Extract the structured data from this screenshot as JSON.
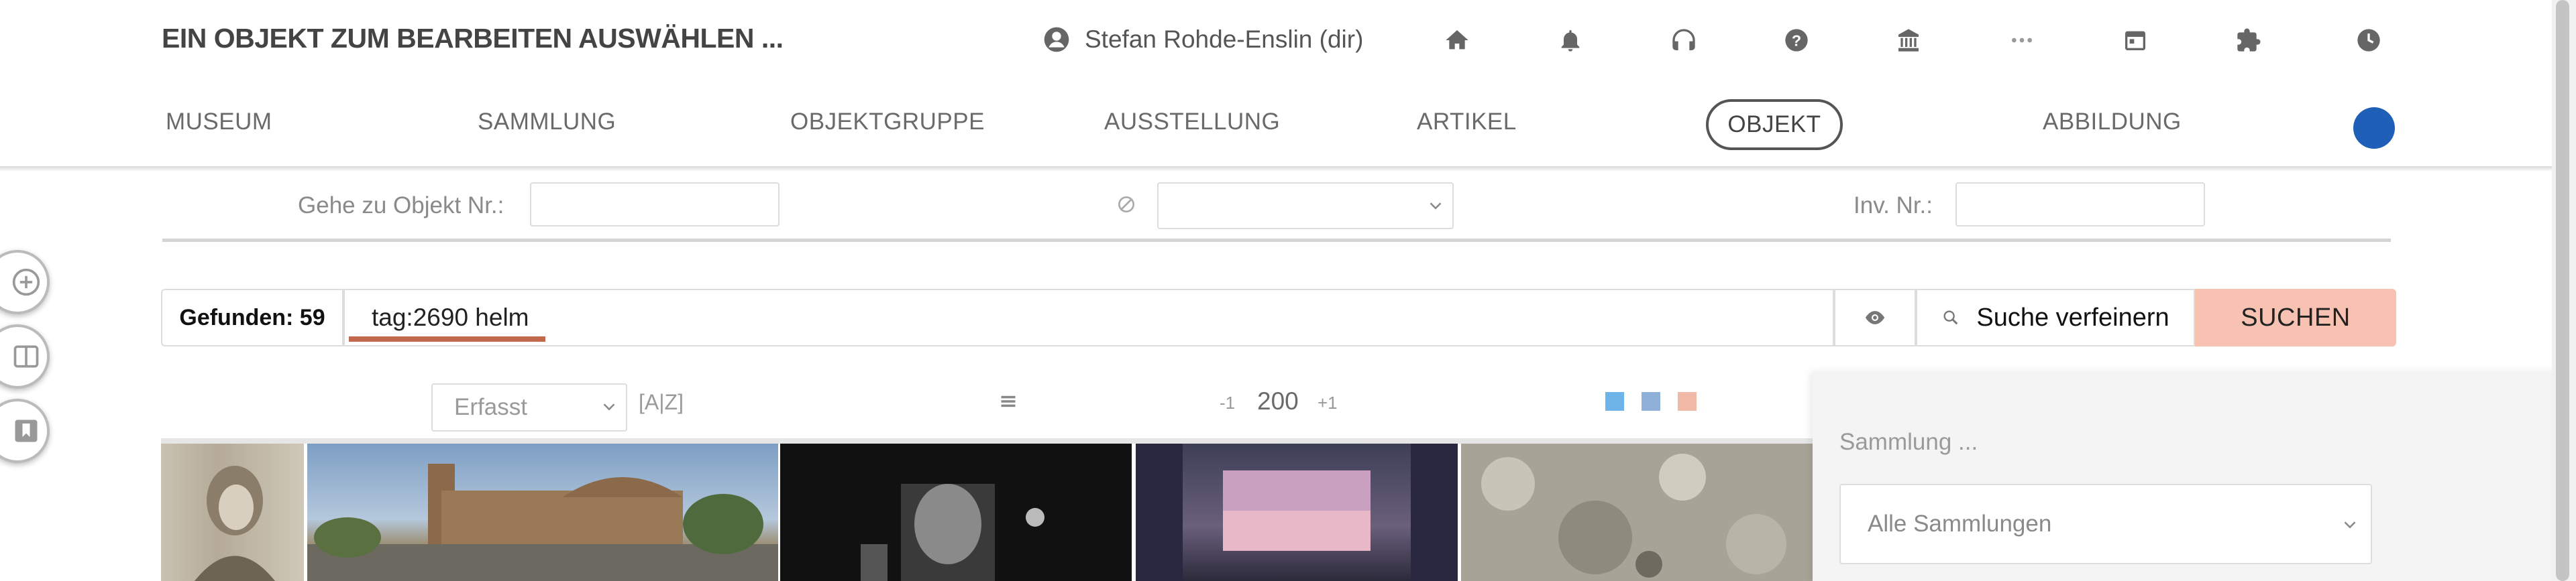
{
  "header": {
    "title": "EIN OBJEKT ZUM BEARBEITEN AUSWÄHLEN ...",
    "user_name": "Stefan Rohde-Enslin (dir)",
    "icons": [
      "home-icon",
      "bell-icon",
      "help-icon",
      "question-icon",
      "museum-icon",
      "more-icon",
      "calendar-icon",
      "puzzle-icon",
      "clock-icon"
    ]
  },
  "nav": {
    "tabs": [
      "MUSEUM",
      "SAMMLUNG",
      "OBJEKTGRUPPE",
      "AUSSTELLUNG",
      "ARTIKEL",
      "OBJEKT",
      "ABBILDUNG"
    ],
    "active": "OBJEKT",
    "avatar_color": "#1f5fb8"
  },
  "side_buttons": [
    "add-icon",
    "book-icon",
    "bookmark-icon"
  ],
  "filter": {
    "goto_label": "Gehe zu Objekt Nr.:",
    "goto_value": "",
    "status_value": "",
    "inv_label": "Inv. Nr.:",
    "inv_value": ""
  },
  "search": {
    "found_label": "Gefunden: 59",
    "query": "tag:2690 helm",
    "refine_label": "Suche verfeinern",
    "search_label": "SUCHEN",
    "accent_color": "#f8c2b2"
  },
  "results_toolbar": {
    "sort_value": "Erfasst",
    "sort_az": "[A|Z]",
    "prev": "-1",
    "page_size": "200",
    "next": "+1",
    "view_colors": [
      "#6fb4e8",
      "#8fb0d8",
      "#f2b8a8"
    ]
  },
  "side_panel": {
    "label": "Sammlung ...",
    "collection_value": "Alle Sammlungen"
  }
}
